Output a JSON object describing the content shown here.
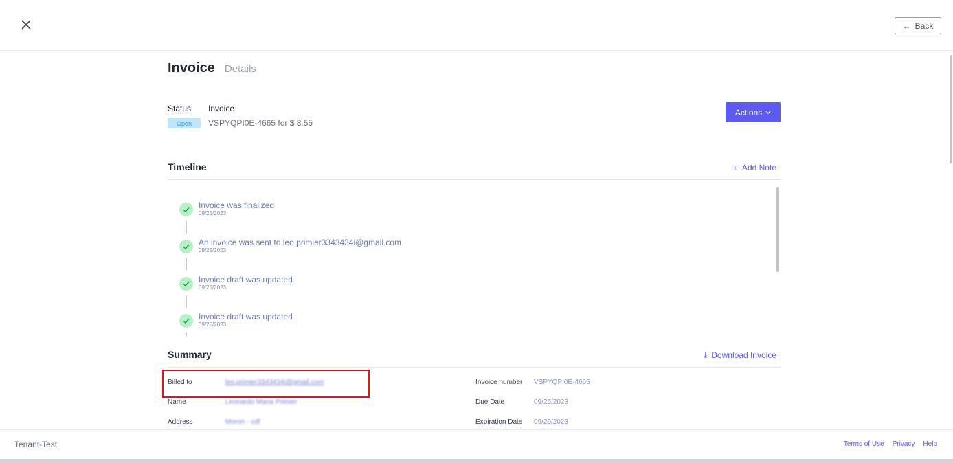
{
  "header": {
    "close_icon": "close-icon",
    "back_label": "Back",
    "back_arrow": "←"
  },
  "page": {
    "title": "Invoice",
    "subtitle": "Details"
  },
  "status": {
    "status_label": "Status",
    "invoice_label": "Invoice",
    "badge": "Open",
    "summary": "VSPYQPI0E-4665 for $ 8.55"
  },
  "actions": {
    "label": "Actions",
    "chevron": "⌄"
  },
  "timeline": {
    "title": "Timeline",
    "add_note_label": "Add Note",
    "add_note_icon": "+",
    "items": [
      {
        "text": "Invoice was finalized",
        "date": "09/25/2023"
      },
      {
        "text": "An invoice was sent to leo.primier3343434i@gmail.com",
        "date": "09/25/2023"
      },
      {
        "text": "Invoice draft was updated",
        "date": "09/25/2023"
      },
      {
        "text": "Invoice draft was updated",
        "date": "09/25/2023"
      }
    ]
  },
  "summary": {
    "title": "Summary",
    "download_label": "Download Invoice",
    "download_icon": "⤓",
    "billed_to_label": "Billed to",
    "billed_to_value": "leo.primier3343434i@gmail.com",
    "name_label": "Name",
    "name_value": "Leonardo Maria Primier",
    "address_label": "Address",
    "address_value": "Moron - cdf",
    "invoice_number_label": "Invoice number",
    "invoice_number_value": "VSPYQPI0E-4665",
    "due_date_label": "Due Date",
    "due_date_value": "09/25/2023",
    "expiration_label": "Expiration Date",
    "expiration_value": "09/29/2023"
  },
  "footer": {
    "tenant": "Tenant-Test",
    "links": [
      "Terms of Use",
      "Privacy",
      "Help"
    ]
  },
  "colors": {
    "accent": "#5b5bf0",
    "badge_bg": "#bfe6fb",
    "check_bg": "#b6f0c4",
    "highlight": "#e0141e"
  }
}
